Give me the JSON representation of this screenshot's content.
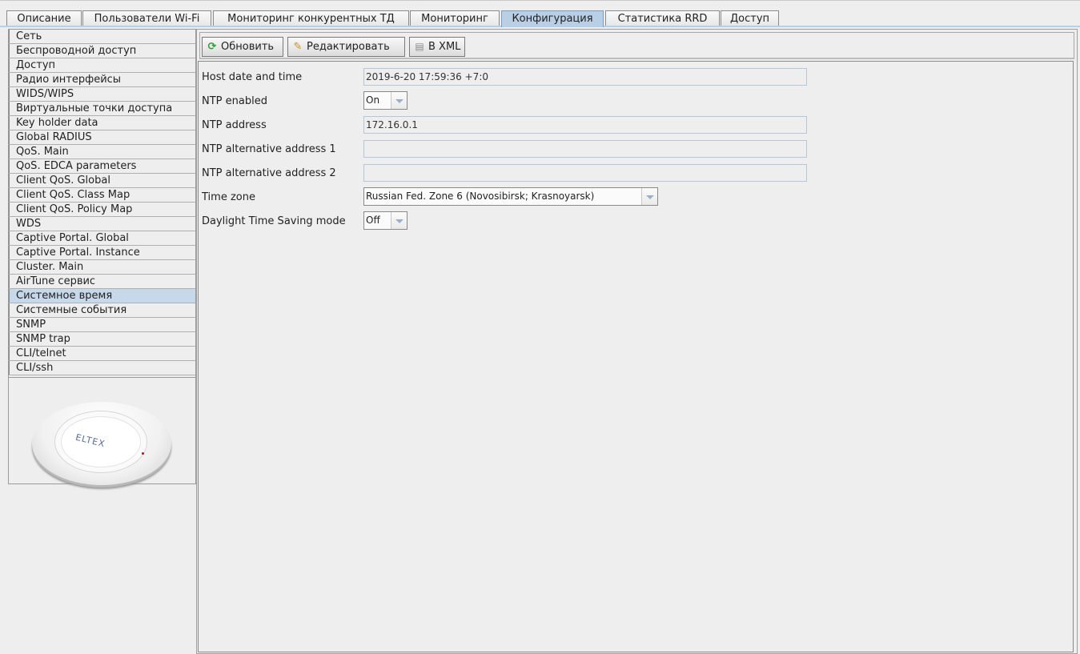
{
  "tabs": [
    {
      "label": "Описание",
      "active": false
    },
    {
      "label": "Пользователи Wi-Fi",
      "active": false
    },
    {
      "label": "Мониторинг конкурентных ТД",
      "active": false
    },
    {
      "label": "Мониторинг",
      "active": false
    },
    {
      "label": "Конфигурация",
      "active": true
    },
    {
      "label": "Статистика RRD",
      "active": false
    },
    {
      "label": "Доступ",
      "active": false
    }
  ],
  "sidebar": {
    "items": [
      {
        "label": "Сеть"
      },
      {
        "label": "Беспроводной доступ"
      },
      {
        "label": "Доступ"
      },
      {
        "label": "Радио интерфейсы"
      },
      {
        "label": "WIDS/WIPS"
      },
      {
        "label": "Виртуальные точки доступа"
      },
      {
        "label": "Key holder data"
      },
      {
        "label": "Global RADIUS"
      },
      {
        "label": "QoS. Main"
      },
      {
        "label": "QoS. EDCA parameters"
      },
      {
        "label": "Client QoS. Global"
      },
      {
        "label": "Client QoS. Class Map"
      },
      {
        "label": "Client QoS. Policy Map"
      },
      {
        "label": "WDS"
      },
      {
        "label": "Captive Portal. Global"
      },
      {
        "label": "Captive Portal. Instance"
      },
      {
        "label": "Cluster. Main"
      },
      {
        "label": "AirTune сервис"
      },
      {
        "label": "Системное время",
        "active": true
      },
      {
        "label": "Системные события"
      },
      {
        "label": "SNMP"
      },
      {
        "label": "SNMP trap"
      },
      {
        "label": "CLI/telnet"
      },
      {
        "label": "CLI/ssh"
      }
    ],
    "device_logo_text": "ELTEX"
  },
  "toolbar": {
    "refresh_label": "Обновить",
    "edit_label": "Редактировать",
    "xml_label": "В XML",
    "refresh_icon": "refresh-icon",
    "edit_icon": "pencil-icon",
    "xml_icon": "document-icon"
  },
  "form": {
    "host_date_label": "Host date and time",
    "host_date_value": "2019-6-20 17:59:36 +7:0",
    "ntp_enabled_label": "NTP enabled",
    "ntp_enabled_value": "On",
    "ntp_address_label": "NTP address",
    "ntp_address_value": "172.16.0.1",
    "ntp_alt1_label": "NTP alternative address 1",
    "ntp_alt1_value": "",
    "ntp_alt2_label": "NTP alternative address 2",
    "ntp_alt2_value": "",
    "timezone_label": "Time zone",
    "timezone_value": "Russian Fed. Zone 6 (Novosibirsk; Krasnoyarsk)",
    "dst_label": "Daylight Time Saving mode",
    "dst_value": "Off"
  },
  "colors": {
    "active_tab": "#b8cfe5",
    "active_nav": "#c6d8ea",
    "background": "#eeeeee"
  }
}
